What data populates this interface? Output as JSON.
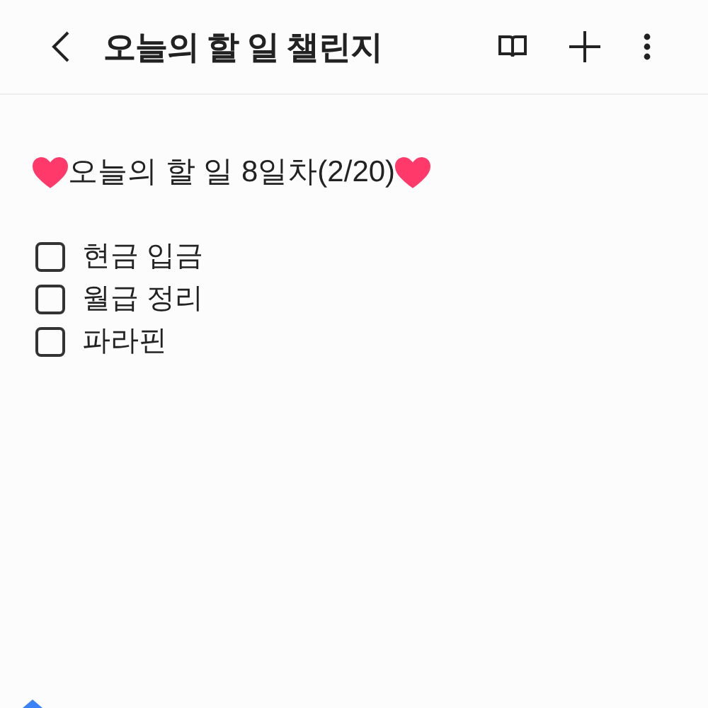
{
  "app_bar": {
    "title": "오늘의 할 일 챌린지"
  },
  "note": {
    "heading": "오늘의 할 일 8일차(2/20)",
    "items": [
      {
        "text": "현금 입금",
        "checked": false
      },
      {
        "text": "월급 정리",
        "checked": false
      },
      {
        "text": "파라핀",
        "checked": false
      }
    ]
  }
}
